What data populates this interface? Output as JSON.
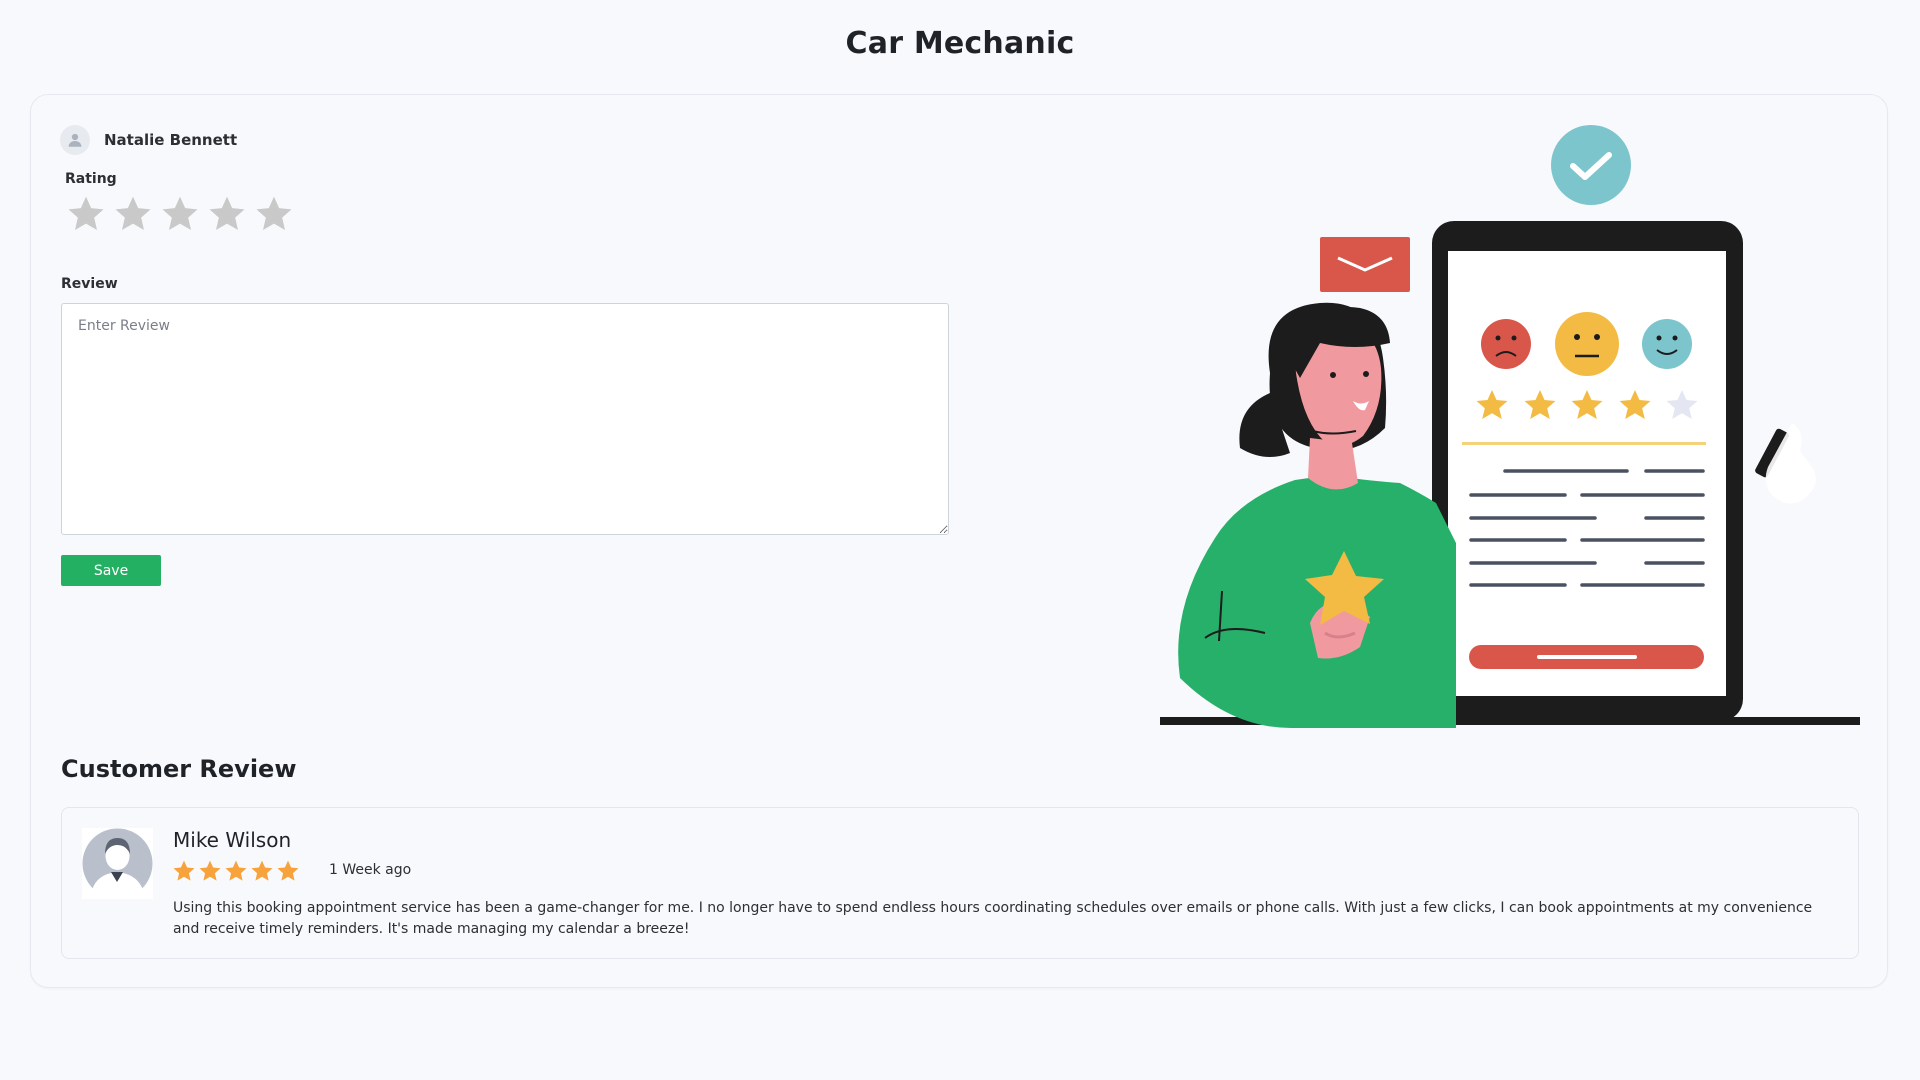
{
  "page": {
    "title": "Car Mechanic"
  },
  "form": {
    "reviewer_name": "Natalie Bennett",
    "rating_label": "Rating",
    "rating_value": 0,
    "rating_max": 5,
    "review_label": "Review",
    "review_placeholder": "Enter Review",
    "review_value": "",
    "save_label": "Save"
  },
  "customer_review": {
    "section_title": "Customer Review",
    "items": [
      {
        "name": "Mike Wilson",
        "rating": 5,
        "time": "1 Week ago",
        "text": "Using this booking appointment service has been a game-changer for me. I no longer have to spend endless hours coordinating schedules over emails or phone calls. With just a few clicks, I can book appointments at my convenience and receive timely reminders. It's made managing my calendar a breeze!"
      }
    ]
  },
  "colors": {
    "accent_green": "#24b063",
    "star_empty": "#c9c9c9",
    "star_filled": "#f7a23b",
    "background": "#f8f9fc"
  },
  "icons": {
    "reviewer_avatar": "user-icon",
    "rating_star": "star-icon",
    "illustration": "rating-review-illustration"
  }
}
